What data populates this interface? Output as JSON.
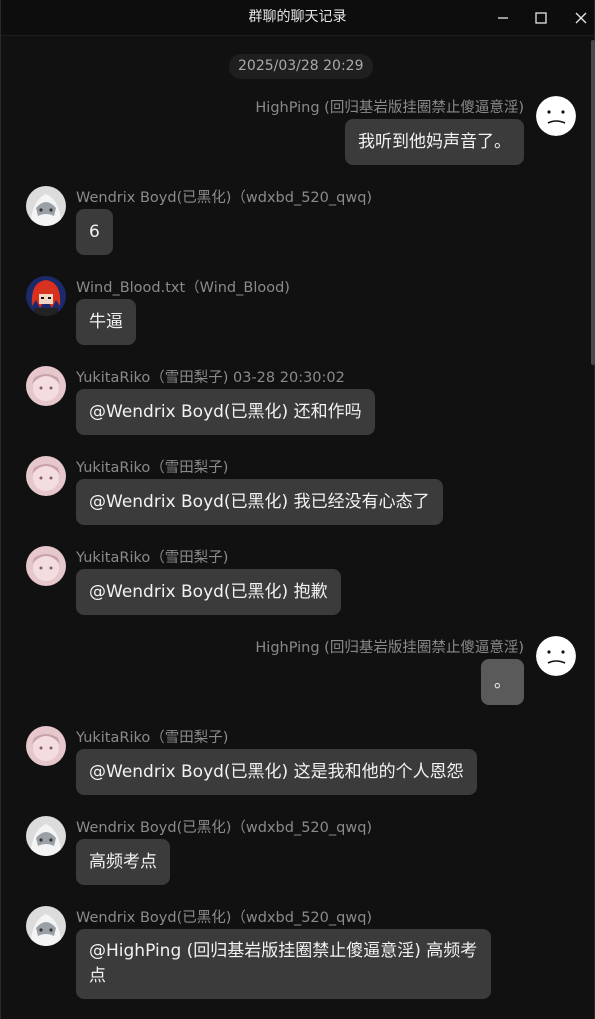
{
  "window": {
    "title": "群聊的聊天记录",
    "controls": [
      "minimize",
      "maximize",
      "close"
    ]
  },
  "timestamp": "2025/03/28 20:29",
  "messages": [
    {
      "side": "right",
      "avatar": "face-icon",
      "sender": "HighPing (回归基岩版挂圈禁止傻逼意淫)",
      "text": "我听到他妈声音了。"
    },
    {
      "side": "left",
      "avatar": "white-hair-avatar",
      "sender": "Wendrix Boyd(已黑化)（wdxbd_520_qwq)",
      "text": "6"
    },
    {
      "side": "left",
      "avatar": "red-hair-avatar",
      "sender": "Wind_Blood.txt（Wind_Blood)",
      "text": "牛逼"
    },
    {
      "side": "left",
      "avatar": "pink-avatar",
      "sender": "YukitaRiko（雪田梨子)   03-28 20:30:02",
      "text": "@Wendrix Boyd(已黑化) 还和作吗"
    },
    {
      "side": "left",
      "avatar": "pink-avatar",
      "sender": "YukitaRiko（雪田梨子)",
      "text": "@Wendrix Boyd(已黑化) 我已经没有心态了"
    },
    {
      "side": "left",
      "avatar": "pink-avatar",
      "sender": "YukitaRiko（雪田梨子)",
      "text": "@Wendrix Boyd(已黑化) 抱歉"
    },
    {
      "side": "right",
      "avatar": "face-icon",
      "sender": "HighPing (回归基岩版挂圈禁止傻逼意淫)",
      "text": "。"
    },
    {
      "side": "left",
      "avatar": "pink-avatar",
      "sender": "YukitaRiko（雪田梨子)",
      "text": "@Wendrix Boyd(已黑化) 这是我和他的个人恩怨"
    },
    {
      "side": "left",
      "avatar": "white-hair-avatar",
      "sender": "Wendrix Boyd(已黑化)（wdxbd_520_qwq)",
      "text": "高频考点"
    },
    {
      "side": "left",
      "avatar": "white-hair-avatar",
      "sender": "Wendrix Boyd(已黑化)（wdxbd_520_qwq)",
      "text": "@HighPing (回归基岩版挂圈禁止傻逼意淫) 高频考点"
    }
  ]
}
